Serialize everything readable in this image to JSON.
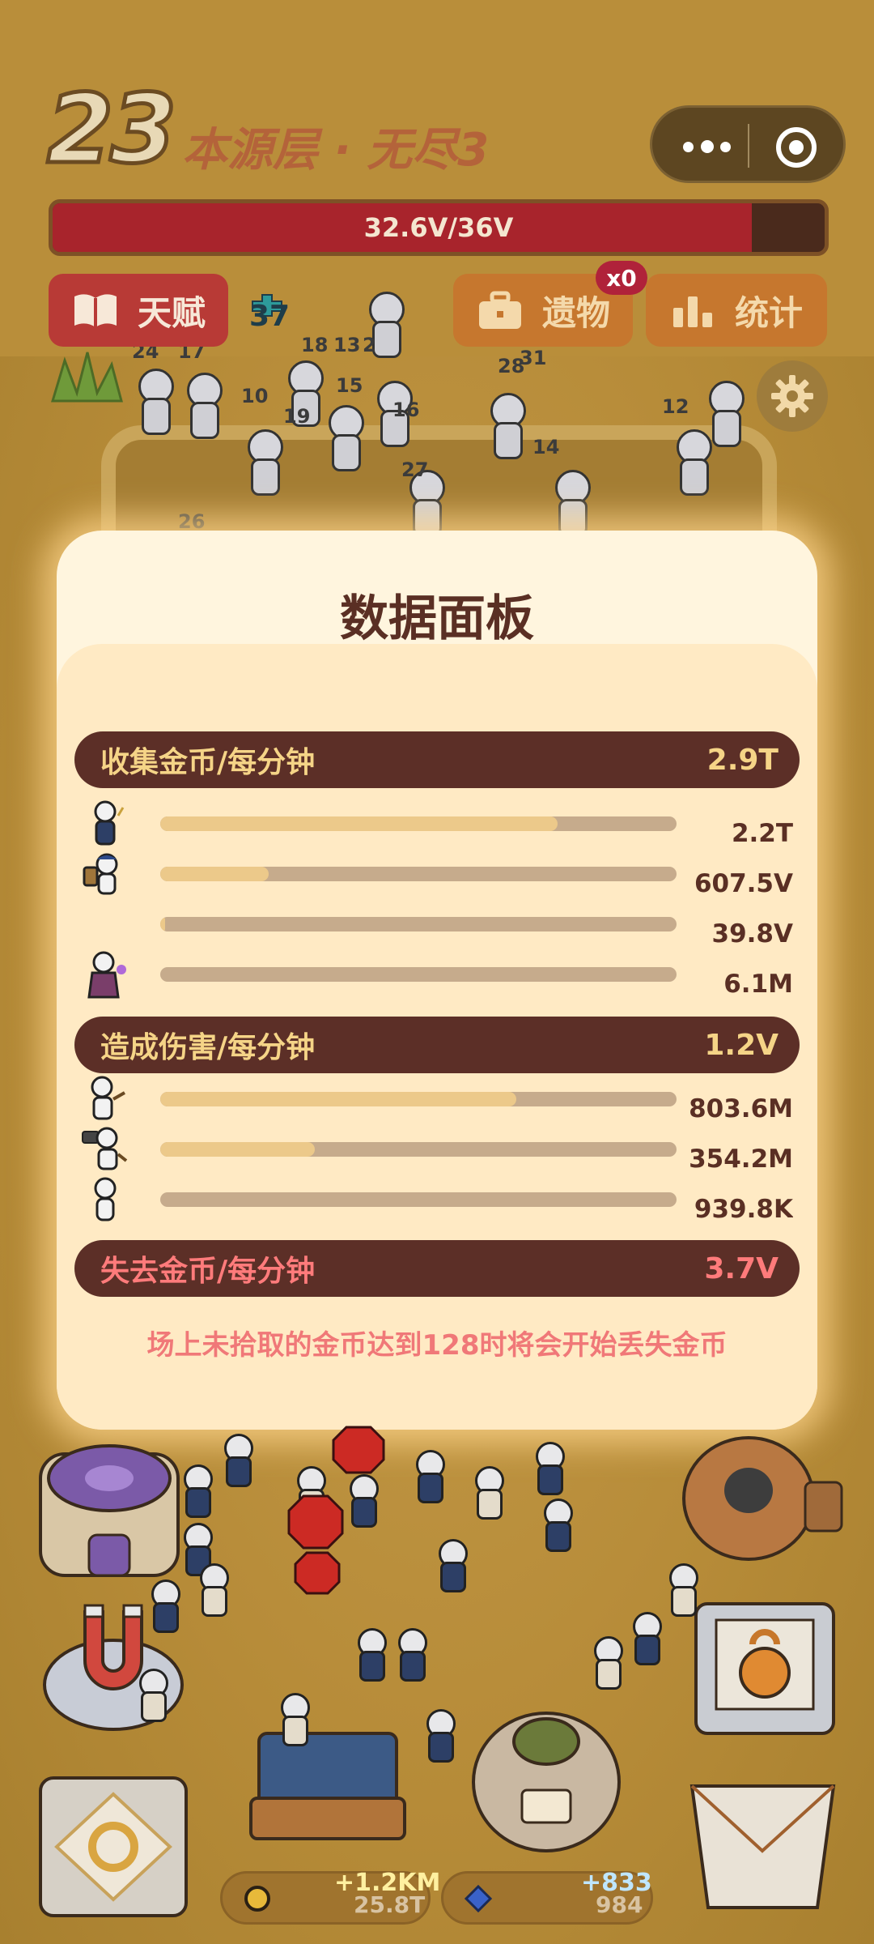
{
  "hud": {
    "floor_number": "23",
    "floor_title": "本源层 · 无尽3",
    "hp_text": "32.6V/36V",
    "hp_fraction": 0.906,
    "talent_label": "天赋",
    "relic_label": "遗物",
    "relic_badge": "x0",
    "stats_label": "统计",
    "level_indicator": "37"
  },
  "colors": {
    "hp_fill": "#a8242c",
    "modal_bg": "#fff5de",
    "section_header_bg": "#5c2f27",
    "gold_text": "#f5d487",
    "loss_text": "#ff7b7b"
  },
  "modal": {
    "title": "数据面板",
    "sections": [
      {
        "label": "收集金币/每分钟",
        "total": "2.9T",
        "rows": [
          {
            "icon": "mage-unit-icon",
            "fill": 0.77,
            "value": "2.2T"
          },
          {
            "icon": "porter-unit-icon",
            "fill": 0.21,
            "value": "607.5V"
          },
          {
            "icon": "",
            "fill": 0.01,
            "value": "39.8V"
          },
          {
            "icon": "wizard-unit-icon",
            "fill": 0.0,
            "value": "6.1M"
          }
        ]
      },
      {
        "label": "造成伤害/每分钟",
        "total": "1.2V",
        "rows": [
          {
            "icon": "archer-unit-icon",
            "fill": 0.69,
            "value": "803.6M"
          },
          {
            "icon": "hammer-unit-icon",
            "fill": 0.3,
            "value": "354.2M"
          },
          {
            "icon": "basic-unit-icon",
            "fill": 0.0,
            "value": "939.8K"
          }
        ]
      },
      {
        "label": "失去金币/每分钟",
        "total": "3.7V"
      }
    ],
    "warning": "场上未拾取的金币达到128时将会开始丢失金币"
  },
  "resources": {
    "gold_value": "25.8T",
    "gold_gain": "+1.2KM",
    "gem_value": "984",
    "gem_gain": "+833"
  },
  "battle_numbers": [
    "24",
    "17",
    "18",
    "13",
    "2",
    "10",
    "15",
    "19",
    "16",
    "28",
    "31",
    "12",
    "14",
    "27",
    "26"
  ]
}
